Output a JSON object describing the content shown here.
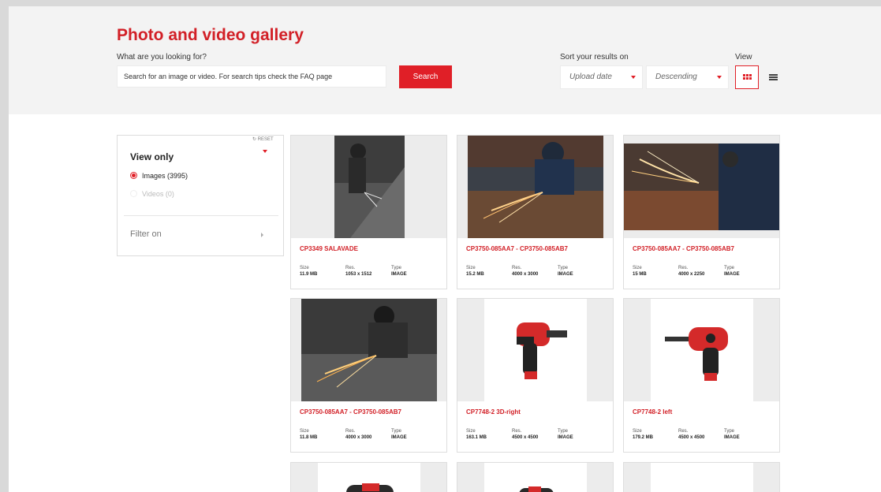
{
  "header": {
    "title": "Photo and video gallery",
    "search_label": "What are you looking for?",
    "search_placeholder": "Search for an image or video. For search tips check the FAQ page",
    "search_button": "Search",
    "sort_label": "Sort your results on",
    "sort_field": "Upload date",
    "sort_order": "Descending",
    "view_label": "View"
  },
  "sidebar": {
    "reset": "↻ RESET",
    "view_only": "View only",
    "images": "Images (3995)",
    "videos": "Videos (0)",
    "filter_on": "Filter on"
  },
  "meta_labels": {
    "size": "Size",
    "res": "Res.",
    "type": "Type"
  },
  "cards": [
    {
      "title": "CP3349 SALAVADE",
      "size": "11.9 MB",
      "res": "1053 x 1512",
      "type": "IMAGE"
    },
    {
      "title": "CP3750-085AA7 - CP3750-085AB7",
      "size": "15.2 MB",
      "res": "4000 x 3000",
      "type": "IMAGE"
    },
    {
      "title": "CP3750-085AA7 - CP3750-085AB7",
      "size": "15 MB",
      "res": "4000 x 2250",
      "type": "IMAGE"
    },
    {
      "title": "CP3750-085AA7 - CP3750-085AB7",
      "size": "11.8 MB",
      "res": "4000 x 3000",
      "type": "IMAGE"
    },
    {
      "title": "CP7748-2 3D-right",
      "size": "163.1 MB",
      "res": "4500 x 4500",
      "type": "IMAGE"
    },
    {
      "title": "CP7748-2 left",
      "size": "179.2 MB",
      "res": "4500 x 4500",
      "type": "IMAGE"
    }
  ],
  "colors": {
    "brand_red": "#e01f27",
    "header_bg": "#f3f3f3"
  }
}
